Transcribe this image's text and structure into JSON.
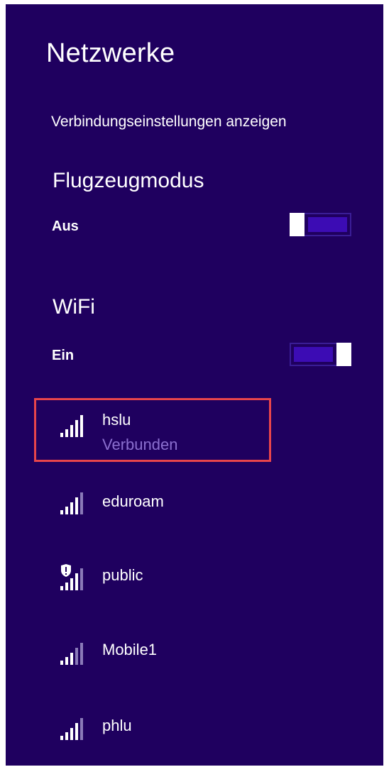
{
  "colors": {
    "background": "#1f005f",
    "text": "#ffffff",
    "toggle_fill": "#3c0cb4",
    "status_text": "#8b6fcf",
    "highlight_border": "#e8454b"
  },
  "header": {
    "title": "Netzwerke",
    "connection_settings_link": "Verbindungseinstellungen anzeigen"
  },
  "airplane_mode": {
    "title": "Flugzeugmodus",
    "state_label": "Aus",
    "enabled": false
  },
  "wifi": {
    "title": "WiFi",
    "state_label": "Ein",
    "enabled": true
  },
  "networks": [
    {
      "name": "hslu",
      "status": "Verbunden",
      "icon": "wifi-signal-full-icon",
      "secured_shield": false,
      "highlighted": true
    },
    {
      "name": "eduroam",
      "status": "",
      "icon": "wifi-signal-icon",
      "secured_shield": false,
      "highlighted": false
    },
    {
      "name": "public",
      "status": "",
      "icon": "wifi-signal-shield-icon",
      "secured_shield": true,
      "highlighted": false
    },
    {
      "name": "Mobile1",
      "status": "",
      "icon": "wifi-signal-icon",
      "secured_shield": false,
      "highlighted": false
    },
    {
      "name": "phlu",
      "status": "",
      "icon": "wifi-signal-icon",
      "secured_shield": false,
      "highlighted": false
    }
  ]
}
